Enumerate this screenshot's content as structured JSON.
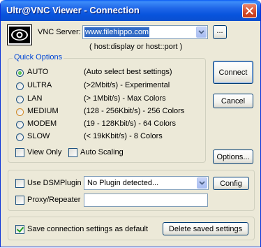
{
  "window": {
    "title": "Ultr@VNC Viewer - Connection"
  },
  "server": {
    "label": "VNC Server:",
    "value": "www.filehippo.com",
    "hint": "( host:display or host::port )",
    "browse_label": "..."
  },
  "quick_options": {
    "title": "Quick Options",
    "options": [
      {
        "label": "AUTO",
        "desc": "(Auto select best settings)",
        "checked": true
      },
      {
        "label": "ULTRA",
        "desc": "(>2Mbit/s) - Experimental",
        "checked": false
      },
      {
        "label": "LAN",
        "desc": "(> 1Mbit/s) - Max Colors",
        "checked": false
      },
      {
        "label": "MEDIUM",
        "desc": "(128 - 256Kbit/s) - 256 Colors",
        "checked": false
      },
      {
        "label": "MODEM",
        "desc": "(19 - 128Kbit/s) - 64 Colors",
        "checked": false
      },
      {
        "label": "SLOW",
        "desc": "(< 19kKbit/s) - 8 Colors",
        "checked": false
      }
    ],
    "view_only": "View Only",
    "auto_scaling": "Auto Scaling"
  },
  "buttons": {
    "connect": "Connect",
    "cancel": "Cancel",
    "options": "Options...",
    "config": "Config",
    "delete_saved": "Delete saved settings"
  },
  "plugin": {
    "use_dsm": "Use DSMPlugin",
    "selected": "No Plugin detected...",
    "proxy": "Proxy/Repeater",
    "proxy_value": ""
  },
  "footer": {
    "save_default": "Save connection settings as default",
    "save_checked": true
  }
}
